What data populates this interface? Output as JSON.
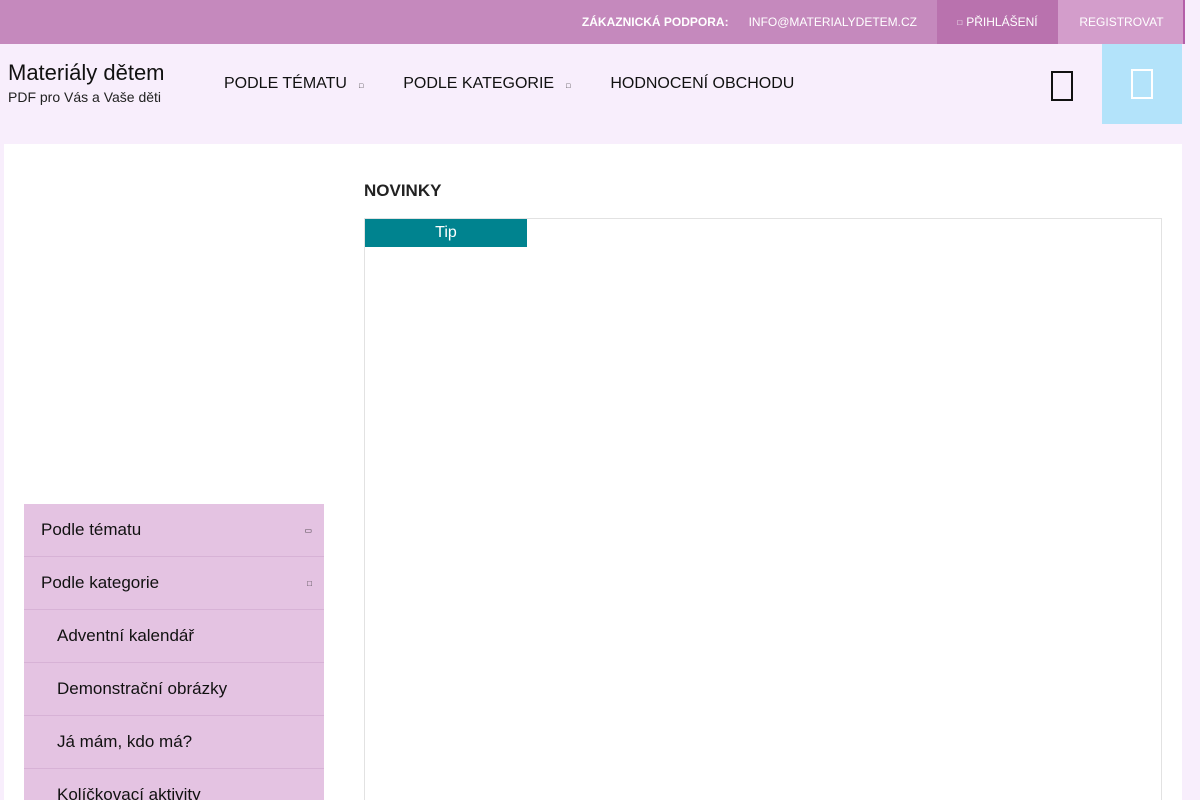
{
  "topbar": {
    "support_label": "Zákaznická podpora:",
    "support_email": "info@materialydetem.cz",
    "login_label": "Přihlášení",
    "register_label": "Registrovat"
  },
  "brand": {
    "title": "Materiály dětem",
    "subtitle": "PDF pro Vás a Vaše děti"
  },
  "nav": {
    "items": [
      {
        "label": "Podle tématu",
        "has_dropdown": true
      },
      {
        "label": "Podle kategorie",
        "has_dropdown": true
      },
      {
        "label": "Hodnocení obchodu",
        "has_dropdown": false
      }
    ]
  },
  "header": {
    "search_icon": "search-icon",
    "cart_icon": "cart-icon"
  },
  "sidebar": {
    "items": [
      {
        "label": "Podle tématu",
        "expander": "collapse"
      },
      {
        "label": "Podle kategorie",
        "expander": "expand"
      },
      {
        "label": "Adventní kalendář"
      },
      {
        "label": "Demonstrační obrázky"
      },
      {
        "label": "Já mám, kdo má?"
      },
      {
        "label": "Kolíčkovací aktivity"
      }
    ]
  },
  "main": {
    "section_title": "Novinky",
    "tip_label": "Tip"
  },
  "colors": {
    "topbar": "#c589bd",
    "login": "#b972ae",
    "register": "#d39dcb",
    "header_bg": "#f8eefc",
    "cart": "#b3e3fa",
    "sidebar": "#e4c3e2",
    "tip": "#00838f"
  }
}
